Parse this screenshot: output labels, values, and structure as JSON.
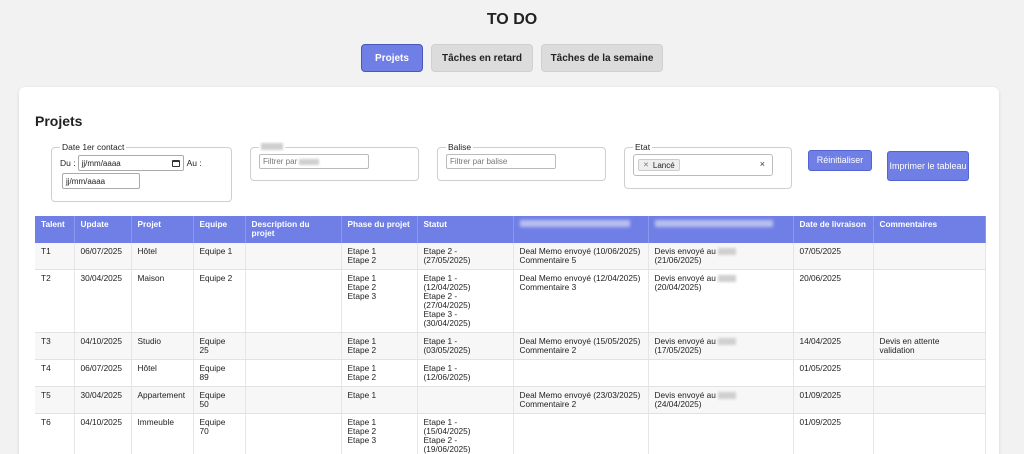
{
  "app_title": "TO DO",
  "tabs": [
    {
      "label": "Projets",
      "active": true
    },
    {
      "label": "Tâches en retard",
      "active": false
    },
    {
      "label": "Tâches de la semaine",
      "active": false
    }
  ],
  "section_title": "Projets",
  "filters": {
    "date": {
      "legend": "Date 1er contact",
      "du_label": "Du :",
      "au_label": "Au :",
      "du_placeholder": "jj/mm/aaaa",
      "au_placeholder": "jj/mm/aaaa"
    },
    "blurred": {
      "placeholder": "Filtrer par"
    },
    "balise": {
      "legend": "Balise",
      "placeholder": "Filtrer par balise"
    },
    "etat": {
      "legend": "Etat",
      "selected": "Lancé"
    }
  },
  "buttons": {
    "reset": "Réinitialiser",
    "print": "Imprimer le tableau"
  },
  "table": {
    "headers": [
      "Talent",
      "Update",
      "Projet",
      "Equipe",
      "Description du projet",
      "Phase du projet",
      "Statut",
      "",
      "",
      "Date de livraison",
      "Commentaires"
    ],
    "rows": [
      {
        "talent": "T1",
        "update": "06/07/2025",
        "projet": "Hôtel",
        "equipe": "Equipe 1",
        "description": "",
        "phase": "Etape 1\nEtape 2",
        "statut": "Etape 2 -\n(27/05/2025)",
        "deal": "Deal Memo envoyé (10/06/2025)\nCommentaire 5",
        "devis_a": "Devis envoyé au",
        "devis_b": "(21/06/2025)",
        "livraison": "07/05/2025",
        "commentaires": ""
      },
      {
        "talent": "T2",
        "update": "30/04/2025",
        "projet": "Maison",
        "equipe": "Equipe 2",
        "description": "",
        "phase": "Etape 1\nEtape 2\nEtape 3",
        "statut": "Etape 1 -\n(12/04/2025)\nEtape 2 -\n(27/04/2025)\nEtape 3 -\n(30/04/2025)",
        "deal": "Deal Memo envoyé (12/04/2025)\nCommentaire 3",
        "devis_a": "Devis envoyé au",
        "devis_b": "(20/04/2025)",
        "livraison": "20/06/2025",
        "commentaires": ""
      },
      {
        "talent": "T3",
        "update": "04/10/2025",
        "projet": "Studio",
        "equipe": "Equipe\n25",
        "description": "",
        "phase": "Etape 1\nEtape 2",
        "statut": "Etape 1 -\n(03/05/2025)",
        "deal": "Deal Memo envoyé (15/05/2025)\nCommentaire 2",
        "devis_a": "Devis envoyé au",
        "devis_b": "(17/05/2025)",
        "livraison": "14/04/2025",
        "commentaires": "Devis en attente\nvalidation"
      },
      {
        "talent": "T4",
        "update": "06/07/2025",
        "projet": "Hôtel",
        "equipe": "Equipe\n89",
        "description": "",
        "phase": "Etape 1\nEtape 2",
        "statut": "Etape 1 -\n(12/06/2025)",
        "deal": "",
        "devis_a": "",
        "devis_b": "",
        "livraison": "01/05/2025",
        "commentaires": ""
      },
      {
        "talent": "T5",
        "update": "30/04/2025",
        "projet": "Appartement",
        "equipe": "Equipe\n50",
        "description": "",
        "phase": "Etape 1",
        "statut": "",
        "deal": "Deal Memo envoyé (23/03/2025)\nCommentaire 2",
        "devis_a": "Devis envoyé au",
        "devis_b": "(24/04/2025)",
        "livraison": "01/09/2025",
        "commentaires": ""
      },
      {
        "talent": "T6",
        "update": "04/10/2025",
        "projet": "Immeuble",
        "equipe": "Equipe\n70",
        "description": "",
        "phase": "Etape 1\nEtape 2\nEtape 3",
        "statut": "Etape 1 -\n(15/04/2025)\nEtape 2 -\n(19/06/2025)",
        "deal": "",
        "devis_a": "",
        "devis_b": "",
        "livraison": "01/09/2025",
        "commentaires": ""
      }
    ]
  }
}
